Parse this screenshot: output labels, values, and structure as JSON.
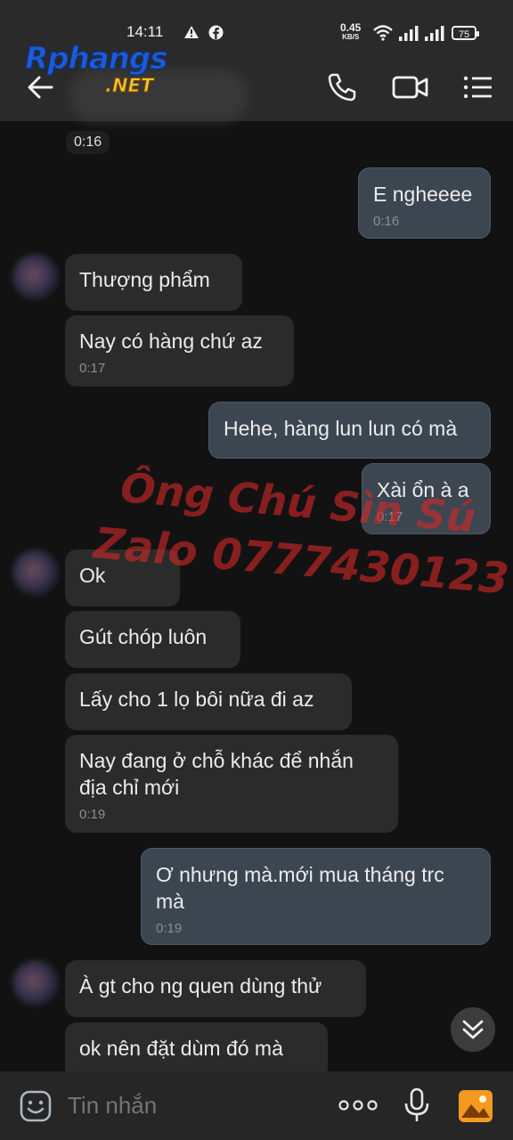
{
  "status_bar": {
    "time": "14:11",
    "net_speed_value": "0.45",
    "net_speed_unit": "KB/S",
    "battery": "75"
  },
  "header": {
    "logo_text": "Rphangs",
    "logo_net": ".NET"
  },
  "chat": {
    "top_time": "0:16",
    "messages": [
      {
        "text": "E ngheeee",
        "time": "0:16"
      },
      {
        "text": "Thượng phẩm"
      },
      {
        "text": "Nay có hàng chứ az",
        "time": "0:17"
      },
      {
        "text": "Hehe, hàng lun lun có mà"
      },
      {
        "text": "Xài ổn à a",
        "time": "0:17"
      },
      {
        "text": "Ok"
      },
      {
        "text": "Gút chóp luôn"
      },
      {
        "text": "Lấy cho 1 lọ bôi nữa đi az"
      },
      {
        "text": "Nay đang ở chỗ khác để nhắn địa chỉ mới",
        "time": "0:19"
      },
      {
        "text": "Ơ nhưng mà.mới mua tháng trc mà",
        "time": "0:19"
      },
      {
        "text": "À gt cho ng quen dùng thử"
      },
      {
        "text": "ok nên đặt dùm đó mà"
      }
    ]
  },
  "watermark": {
    "line1": "Ông Chú Sìn Sú",
    "line2": "Zalo 0777430123"
  },
  "input": {
    "placeholder": "Tin nhắn"
  },
  "colors": {
    "incoming_bubble": "#2b2b2b",
    "outgoing_bubble": "#3b4651",
    "background": "#121212",
    "watermark": "#d22828"
  }
}
